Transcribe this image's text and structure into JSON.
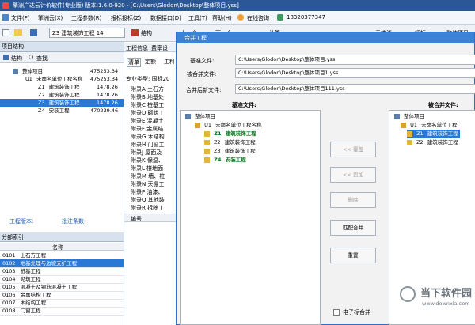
{
  "window": {
    "title": "擎洲广达云计价软件(专业版) 版本:1.6.0-920 - [C:\\Users\\Glodon\\Desktop\\整体项目.yss]"
  },
  "menu": {
    "items": [
      "文件(F)",
      "擎洲云(X)",
      "工程参数(R)",
      "报标投标(Z)",
      "数据接口(D)",
      "工具(T)",
      "帮助(H)",
      "在线咨询",
      "18320377347"
    ]
  },
  "toolbar": {
    "combo_value": "Z3  建筑装饰工程 14",
    "struct_label": "结构",
    "up_label": "上一个",
    "down_label": "下一个",
    "calc_label": "计算",
    "cloud_label": "云端资",
    "compare_label": "招标",
    "whole_label": "整体项目"
  },
  "left_panel": {
    "title": "项目结构",
    "tabs": [
      "结构",
      "查找"
    ],
    "tree": [
      {
        "code": "",
        "name": "整体项目",
        "value": "475253.34"
      },
      {
        "code": "U1",
        "name": "未命名单位工程名称",
        "value": "475253.34"
      },
      {
        "code": "Z1",
        "name": "建筑装饰工程",
        "value": "1478.26"
      },
      {
        "code": "Z2",
        "name": "建筑装饰工程",
        "value": "1478.26"
      },
      {
        "code": "Z3",
        "name": "建筑装饰工程",
        "value": "1478.26"
      },
      {
        "code": "Z4",
        "name": "安装工程",
        "value": "470239.46"
      }
    ],
    "footer_left": "工程版本:",
    "footer_right": "批注条数:",
    "index_title": "分部索引",
    "index_header": "名称",
    "index_rows": [
      {
        "code": "0101",
        "name": "土石方工程"
      },
      {
        "code": "0102",
        "name": "地基处理与边坡支护工程"
      },
      {
        "code": "0103",
        "name": "桩基工程"
      },
      {
        "code": "0104",
        "name": "砌筑工程"
      },
      {
        "code": "0105",
        "name": "混凝土及钢筋混凝土工程"
      },
      {
        "code": "0106",
        "name": "金属结构工程"
      },
      {
        "code": "0107",
        "name": "木结构工程"
      },
      {
        "code": "0108",
        "name": "门窗工程"
      }
    ]
  },
  "mid_panel": {
    "tabs": [
      "工程信息",
      "费率设"
    ],
    "subtabs": [
      "清单",
      "定额",
      "工料"
    ],
    "spec_label": "专业类型: 国标20",
    "items": [
      "附录A 土石方",
      "附录B 地基处",
      "附录C 桩基工",
      "附录D 砌筑工",
      "附录E 混凝土",
      "附录F 金属结",
      "附录G 木结构",
      "附录H 门窗工",
      "附录J 屋面及",
      "附录K 保温、",
      "附录L 楼地面",
      "附录M 墙、柱",
      "附录N 天棚工",
      "附录P 油漆、",
      "附录Q 其他装",
      "附录R 拆除工"
    ],
    "col_header": "编号"
  },
  "dialog": {
    "title": "合并工程",
    "base_file_label": "基准文件:",
    "base_file_value": "C:\\Users\\Glodon\\Desktop\\整体项目.yss",
    "merged_file_label": "被合并文件:",
    "merged_file_value": "C:\\Users\\Glodon\\Desktop\\整体项目1.yss",
    "after_file_label": "合并后新文件:",
    "after_file_value": "C:\\Users\\Glodon\\Desktop\\整体项目111.yss",
    "base_tree_title": "基准文件:",
    "merge_tree_title": "被合并文件:",
    "base_tree": [
      {
        "code": "",
        "name": "整体项目"
      },
      {
        "code": "U1",
        "name": "未命名单位工程名称"
      },
      {
        "code": "Z1",
        "name": "建筑装饰工程"
      },
      {
        "code": "Z2",
        "name": "建筑装饰工程"
      },
      {
        "code": "Z3",
        "name": "建筑装饰工程"
      },
      {
        "code": "Z4",
        "name": "安装工程"
      }
    ],
    "merge_tree": [
      {
        "code": "",
        "name": "整体项目"
      },
      {
        "code": "U1",
        "name": "未命名单位工程"
      },
      {
        "code": "Z1",
        "name": "建筑装饰工程"
      },
      {
        "code": "Z2",
        "name": "建筑装饰工程"
      }
    ],
    "btn_overwrite": "<< 覆盖",
    "btn_append": "<< 追加",
    "btn_delete": "删除",
    "btn_match": "匹配合并",
    "btn_reset": "重置",
    "checkbox_label": "电子标合并"
  },
  "watermark": {
    "cn": "当下软件园",
    "url": "www.downxia.com"
  },
  "colors": {
    "title_bar": "#2b5797",
    "selection": "#2a78d6",
    "green_text": "#0a7a1f",
    "dialog_title": "#3b83d8"
  }
}
